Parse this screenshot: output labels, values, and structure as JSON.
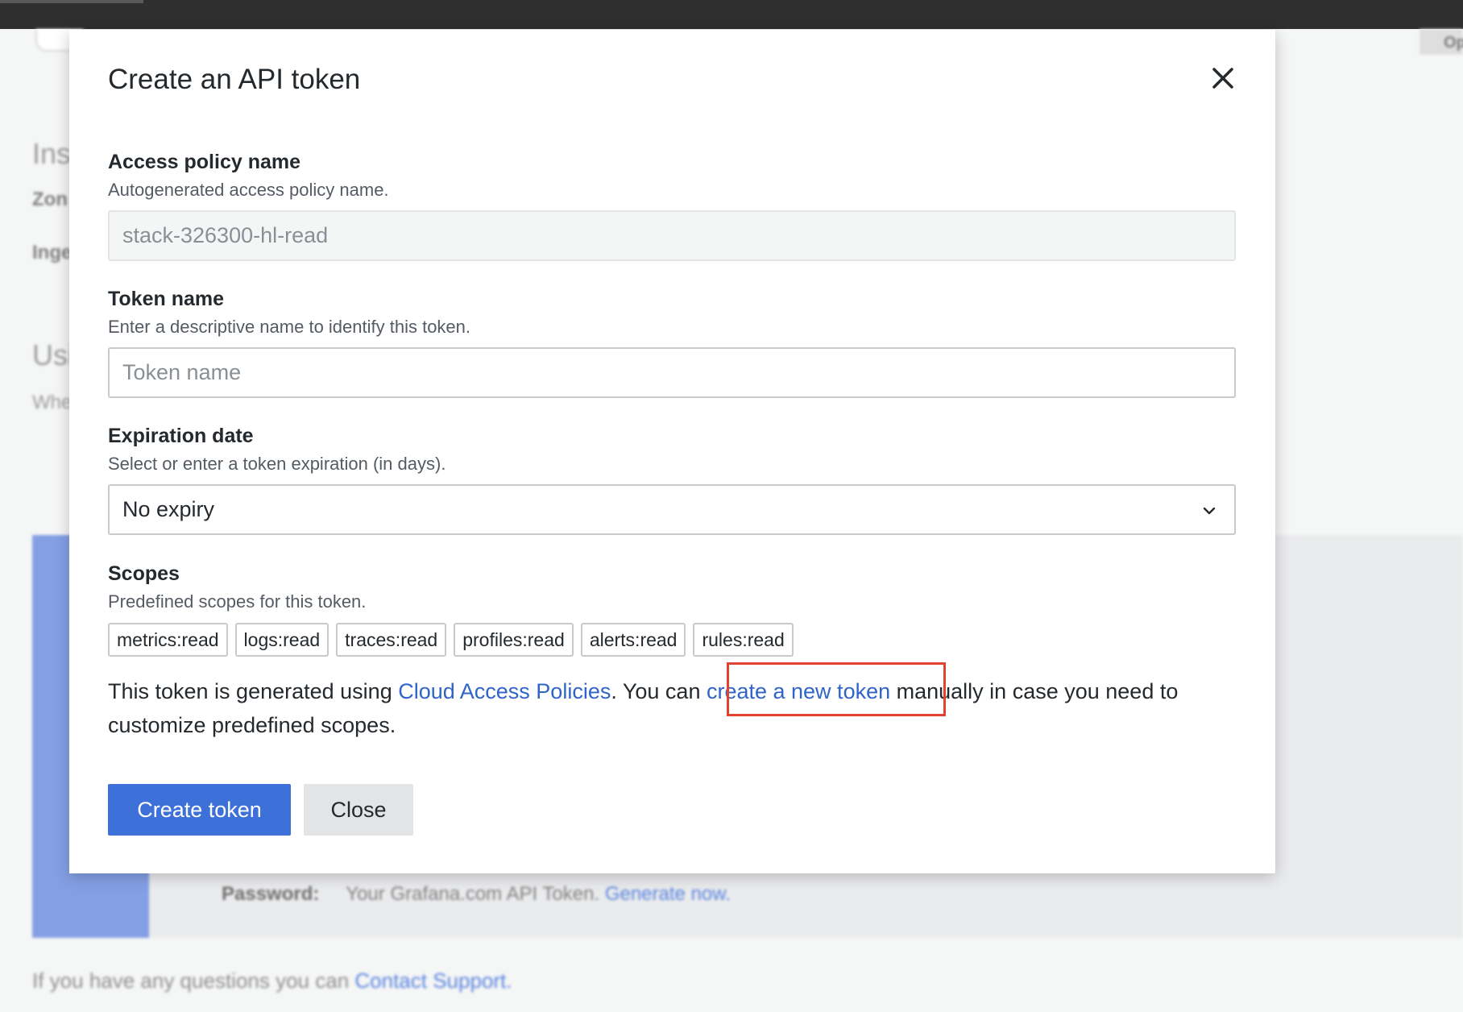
{
  "background": {
    "section_heading_1": "Ins",
    "label_zone": "Zon",
    "label_ingest": "Inge",
    "section_heading_2": "Usi",
    "text_whe": "Whe",
    "right_button": "Op",
    "password_label": "Password:",
    "password_text": "Your Grafana.com API Token.",
    "password_link": "Generate now.",
    "footer_text": "If you have any questions you can",
    "footer_link": "Contact Support."
  },
  "modal": {
    "title": "Create an API token",
    "close_icon": "close-icon",
    "access_policy": {
      "label": "Access policy name",
      "description": "Autogenerated access policy name.",
      "value": "stack-326300-hl-read"
    },
    "token_name": {
      "label": "Token name",
      "description": "Enter a descriptive name to identify this token.",
      "value": "",
      "placeholder": "Token name"
    },
    "expiration": {
      "label": "Expiration date",
      "description": "Select or enter a token expiration (in days).",
      "selected": "No expiry"
    },
    "scopes": {
      "label": "Scopes",
      "description": "Predefined scopes for this token.",
      "items": [
        "metrics:read",
        "logs:read",
        "traces:read",
        "profiles:read",
        "alerts:read",
        "rules:read"
      ]
    },
    "info": {
      "part1": "This token is generated using ",
      "link1": "Cloud Access Policies",
      "part2": ". You can ",
      "link2": "create a new token",
      "part3": " manually in case you need to customize predefined scopes."
    },
    "buttons": {
      "create": "Create token",
      "close": "Close"
    }
  },
  "colors": {
    "primary": "#3d71d9",
    "link": "#2f64c8",
    "highlight": "#e04330"
  }
}
